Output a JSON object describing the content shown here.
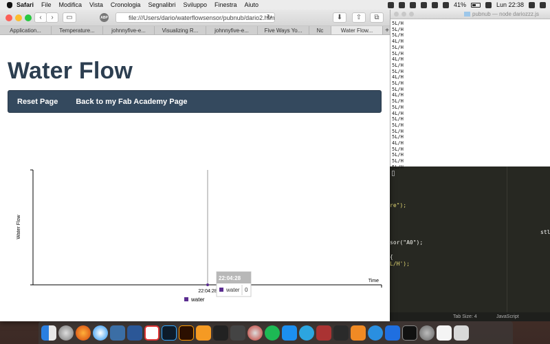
{
  "menubar": {
    "items": [
      "Safari",
      "File",
      "Modifica",
      "Vista",
      "Cronologia",
      "Segnalibri",
      "Sviluppo",
      "Finestra",
      "Aiuto"
    ],
    "battery": "41%",
    "clock": "Lun 22:38"
  },
  "safari": {
    "url": "file:///Users/dario/waterflowsensor/pubnub/dario2.htm",
    "abp_label": "ABP",
    "tabs": [
      "Application...",
      "Temperature...",
      "johnnyfive-e...",
      "Visualizing R...",
      "johnnyfive-e...",
      "Five Ways Yo...",
      "Nc",
      "Water Flow..."
    ],
    "add_tab": "+"
  },
  "page": {
    "title": "Water Flow",
    "nav": [
      "Reset Page",
      "Back to my Fab Academy Page"
    ]
  },
  "chart_data": {
    "type": "line",
    "ylabel": "Water Flow",
    "xlabel": "Time",
    "x": [
      "22:04:28"
    ],
    "series": [
      {
        "name": "water",
        "values": [
          0
        ],
        "color": "#5b2d90"
      }
    ],
    "tooltip": {
      "title": "22:04:28",
      "series": "water",
      "value": "0"
    },
    "legend": "bottom"
  },
  "terminal": {
    "title": "pubnub — node dariozzz.js",
    "lines": [
      "5L/H",
      "5L/H",
      "5L/H",
      "4L/H",
      "5L/H",
      "5L/H",
      "4L/H",
      "5L/H",
      "5L/H",
      "4L/H",
      "5L/H",
      "5L/H",
      "4L/H",
      "5L/H",
      "5L/H",
      "4L/H",
      "5L/H",
      "5L/H",
      "5L/H",
      "5L/H",
      "4L/H",
      "5L/H",
      "5L/H",
      "5L/H",
      "5L/H"
    ]
  },
  "editor": {
    "line1": "re\");",
    "line2": "sor(\"A0\");",
    "line3": "{",
    "line4": "L/H');",
    "side_text": "stl",
    "status_tab": "Tab Size: 4",
    "status_lang": "JavaScript"
  }
}
